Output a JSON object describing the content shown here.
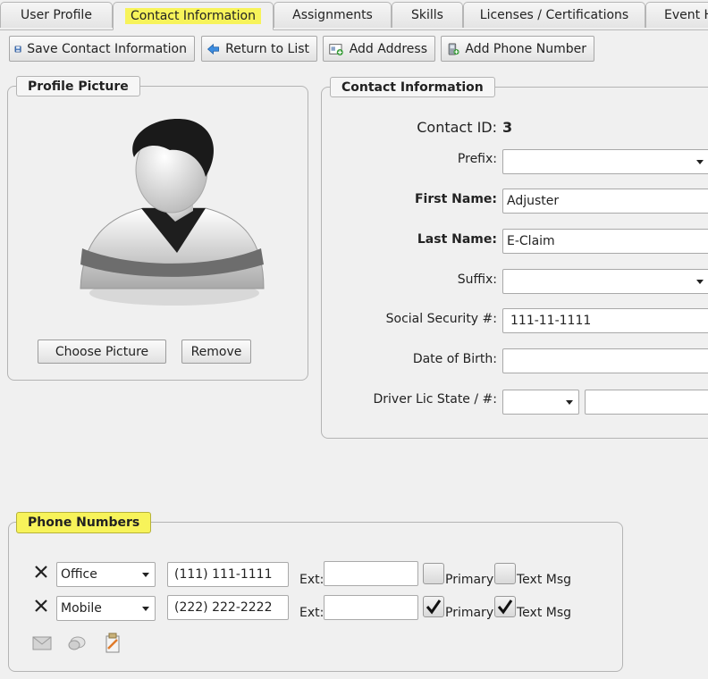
{
  "tabs": [
    {
      "label": "User Profile",
      "active": false
    },
    {
      "label": "Contact Information",
      "active": true
    },
    {
      "label": "Assignments",
      "active": false
    },
    {
      "label": "Skills",
      "active": false
    },
    {
      "label": "Licenses / Certifications",
      "active": false
    },
    {
      "label": "Event H",
      "active": false
    }
  ],
  "toolbar": {
    "save_label": "Save Contact Information",
    "return_label": "Return to List",
    "add_address_label": "Add Address",
    "add_phone_label": "Add Phone Number"
  },
  "profile": {
    "legend": "Profile Picture",
    "choose_label": "Choose Picture",
    "remove_label": "Remove"
  },
  "contact": {
    "legend": "Contact Information",
    "contact_id_label": "Contact ID:",
    "contact_id": "3",
    "prefix_label": "Prefix:",
    "prefix_value": "",
    "first_name_label": "First Name:",
    "first_name": "Adjuster",
    "last_name_label": "Last Name:",
    "last_name": "E-Claim",
    "suffix_label": "Suffix:",
    "suffix_value": "",
    "ssn_label": "Social Security #:",
    "ssn": "111-11-1111",
    "dob_label": "Date of Birth:",
    "dob": "",
    "driver_label": "Driver Lic State / #:",
    "driver_state": "",
    "driver_number": ""
  },
  "phones": {
    "legend": "Phone Numbers",
    "ext_label": "Ext:",
    "primary_label": "Primary",
    "text_msg_label": "Text Msg",
    "rows": [
      {
        "type": "Office",
        "number": "(111) 111-1111",
        "ext": "",
        "primary": false,
        "text_msg": false
      },
      {
        "type": "Mobile",
        "number": "(222) 222-2222",
        "ext": "",
        "primary": true,
        "text_msg": true
      }
    ]
  },
  "colors": {
    "highlight": "#f7f35a",
    "background": "#f0f0f0"
  }
}
